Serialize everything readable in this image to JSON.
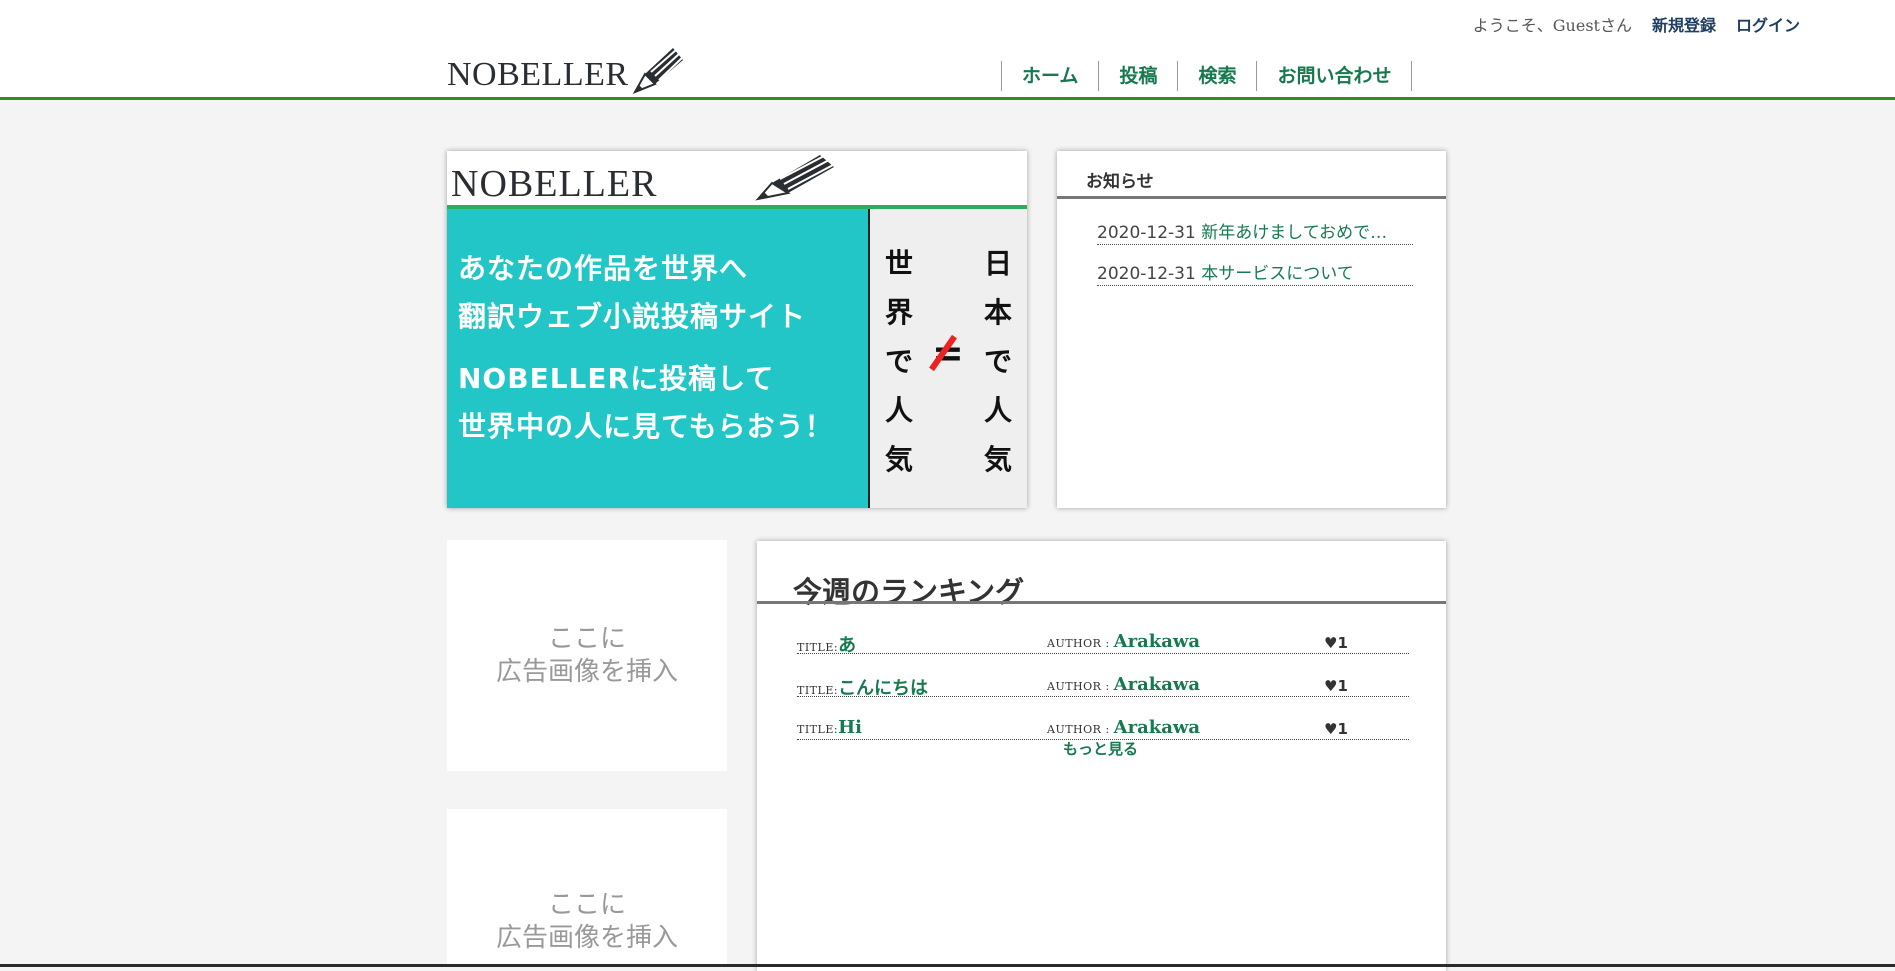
{
  "header": {
    "welcome": "ようこそ、Guestさん",
    "register": "新規登録",
    "login": "ログイン",
    "logo": "NOBELLER",
    "nav": [
      "ホーム",
      "投稿",
      "検索",
      "お問い合わせ"
    ]
  },
  "hero": {
    "logo": "NOBELLER",
    "lines": [
      "あなたの作品を世界へ",
      "翻訳ウェブ小説投稿サイト",
      "NOBELLERに投稿して",
      "世界中の人に見てもらおう！"
    ],
    "left_vertical": [
      "世",
      "界",
      "で",
      "人",
      "気"
    ],
    "right_vertical": [
      "日",
      "本",
      "で",
      "人",
      "気"
    ],
    "neq_symbol": "="
  },
  "notices": {
    "title": "お知らせ",
    "items": [
      {
        "date": "2020-12-31",
        "title": "新年あけましておめで…"
      },
      {
        "date": "2020-12-31",
        "title": "本サービスについて"
      }
    ]
  },
  "ads": [
    {
      "line1": "ここに",
      "line2": "広告画像を挿入"
    },
    {
      "line1": "ここに",
      "line2": "広告画像を挿入"
    }
  ],
  "ranking": {
    "title": "今週のランキング",
    "title_label": "TITLE:",
    "author_label": "AUTHOR : ",
    "heart": "♥",
    "rows": [
      {
        "title": "あ",
        "author": "Arakawa",
        "likes": "1"
      },
      {
        "title": "こんにちは",
        "author": "Arakawa",
        "likes": "1"
      },
      {
        "title": "Hi",
        "author": "Arakawa",
        "likes": "1"
      }
    ],
    "more": "もっと見る"
  },
  "colors": {
    "accent_green": "#167a4e",
    "header_rule": "#2f8f1f",
    "hero_teal": "#22c6c7",
    "hero_rule": "#2cae5c"
  },
  "icons": [
    "pencil-icon",
    "heart-icon"
  ]
}
